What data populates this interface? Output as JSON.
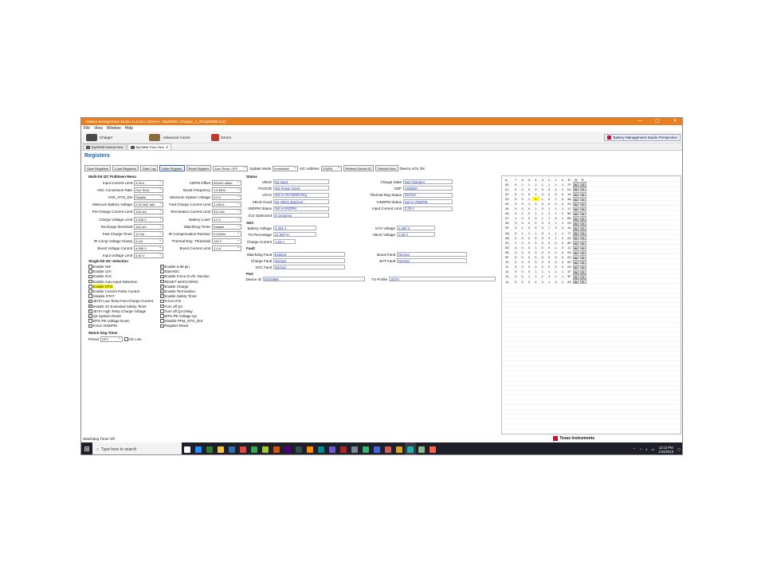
{
  "window": {
    "title": "Battery Management Studio v1.3.34.1 (Device - Bq25898 | Charger_1_00-bq25898.bqz)",
    "controls": [
      "—",
      "▢",
      "✕"
    ]
  },
  "menu": [
    "File",
    "View",
    "Window",
    "Help"
  ],
  "toolbar": {
    "items": [
      {
        "label": "Charger",
        "icon": "charger-icon",
        "color": "#4a4a4a"
      },
      {
        "label": "Advanced Comm",
        "icon": "advanced-comm-icon",
        "color": "#8a6d3b"
      },
      {
        "label": "Errors",
        "icon": "errors-icon",
        "color": "#c0392b"
      }
    ],
    "perspective": "Battery Management Studio Perspective"
  },
  "tabs": [
    {
      "label": "Bq25898 Default View",
      "active": false
    },
    {
      "label": "Bq25898 Field View",
      "active": true
    }
  ],
  "registers_title": "Registers",
  "buttons": {
    "save": "Save Registers",
    "load": "Load Registers",
    "start_log": "Start Log",
    "write": "Write Register",
    "read": "Read Register",
    "auto_read": "Auto Read: OFF",
    "update_mode_label": "Update Mode",
    "update_mode": "Immediate",
    "i2c_label": "I2C Address",
    "i2c": "D6(6B)",
    "refresh": "Refresh Device ID",
    "default_view": "Default View",
    "device_status": "Device ACK OK"
  },
  "multibit": {
    "title": "Multi-bit I2C Pulldown Menu",
    "left": [
      {
        "label": "Input Current Limit",
        "value": "3.25 A"
      },
      {
        "label": "ADC Conversion Rate",
        "value": "One Shot"
      },
      {
        "label": "VOK_OTG_EN",
        "value": "Disable"
      },
      {
        "label": "Minimum Battery Voltage",
        "value": "2.9V BAT falli"
      },
      {
        "label": "Pre-Charge Current Limit",
        "value": "128 mA"
      },
      {
        "label": "Charge Voltage Limit",
        "value": "4.208 V"
      },
      {
        "label": "Recharge threshold",
        "value": "100 mV"
      },
      {
        "label": "Fast Charge Timer",
        "value": "12 hrs"
      },
      {
        "label": "IR Comp Voltage Clamp",
        "value": "0 mV"
      },
      {
        "label": "Boost Voltage Control",
        "value": "4.998 V"
      },
      {
        "label": "Input Voltage Limit",
        "value": "4.40 V"
      }
    ],
    "right": [
      {
        "label": "VDPM Offset",
        "value": "600mV offset"
      },
      {
        "label": "Boost Frequency",
        "value": "1.5 MHz"
      },
      {
        "label": "Minimum System Voltage",
        "value": "3.5 V"
      },
      {
        "label": "Fast Charge Current Limit",
        "value": "2.048 A"
      },
      {
        "label": "Termination Current Limit",
        "value": "512 mA"
      },
      {
        "label": "Battery LowV",
        "value": "3.0 V"
      },
      {
        "label": "WatchDog Timer",
        "value": "Disable"
      },
      {
        "label": "IR Compensation Resistor",
        "value": "0 mOhm"
      },
      {
        "label": "Thermal Reg. Threshold",
        "value": "120 C"
      },
      {
        "label": "Boost Current Limit",
        "value": "2.4 A"
      }
    ]
  },
  "singlebit": {
    "title": "Single-bit I2C Selection",
    "left": [
      {
        "label": "Enable HIZ",
        "checked": false
      },
      {
        "label": "Enable 12V",
        "checked": false
      },
      {
        "label": "Enable ICO",
        "checked": false
      },
      {
        "label": "Enable Auto-Input Detection",
        "checked": false
      },
      {
        "label": "Enable OTG",
        "checked": false,
        "highlight": true
      },
      {
        "label": "Enable Current Pulse Control",
        "checked": false
      },
      {
        "label": "Disable STAT",
        "checked": false
      },
      {
        "label": "JEITA Low Temp Fast Charge Current",
        "checked": true
      },
      {
        "label": "Enable 2X Extended Safety Timer",
        "checked": true
      },
      {
        "label": "JEITA High Temp Charge Voltage",
        "checked": true
      },
      {
        "label": "Q4 System Reset",
        "checked": true
      },
      {
        "label": "MTK-PE Voltage Down",
        "checked": false
      },
      {
        "label": "Force VINDPM",
        "checked": false
      }
    ],
    "right": [
      {
        "label": "Enable ILIM pin",
        "checked": true
      },
      {
        "label": "StartADC",
        "checked": false
      },
      {
        "label": "Enable Force D+/D- Dection",
        "checked": false
      },
      {
        "label": "RESET WATCHDOG",
        "checked": false
      },
      {
        "label": "Enable Charge",
        "checked": true
      },
      {
        "label": "Enable Termination",
        "checked": true
      },
      {
        "label": "Enable Safety Timer",
        "checked": true
      },
      {
        "label": "Force ICO",
        "checked": false
      },
      {
        "label": "Turn off Q4",
        "checked": false
      },
      {
        "label": "Turn off Q4 Delay",
        "checked": false
      },
      {
        "label": "MTK-PE Voltage Up",
        "checked": false
      },
      {
        "label": "Disable PFM_OTG_DIS",
        "checked": false
      },
      {
        "label": "Register Reset",
        "checked": false
      }
    ]
  },
  "watchdog": {
    "title": "Watch Dog Timer",
    "period_label": "Period",
    "period": "OFF",
    "ce_low": "CE Low"
  },
  "status": {
    "title": "Status",
    "left": [
      {
        "label": "VBUS",
        "value": "No Input"
      },
      {
        "label": "PGOOD",
        "value": "Not Power Good"
      },
      {
        "label": "VSYS",
        "value": "Not in VSYSMIN Reg"
      },
      {
        "label": "VBUS Good",
        "value": "No VBUS attached"
      },
      {
        "label": "IINDPM Status",
        "value": "Not in IINDPM"
      },
      {
        "label": "ICO Optimized",
        "value": "In progress"
      }
    ],
    "right": [
      {
        "label": "Charge State",
        "value": "Not Charging"
      },
      {
        "label": "SDP",
        "value": "USB500"
      },
      {
        "label": "Thermal Reg Status",
        "value": "Normal"
      },
      {
        "label": "VINDPM Status",
        "value": "Not in VINDPM"
      },
      {
        "label": "Input Current Limit",
        "value": "3.25 A"
      }
    ]
  },
  "adc": {
    "title": "ADC",
    "battery_voltage": {
      "label": "Battery Voltage",
      "value": "2.304 V"
    },
    "ts_percentage": {
      "label": "TS Percentage",
      "value": "21.000 %"
    },
    "charge_current": {
      "label": "Charge Current",
      "value": "1.55 A"
    },
    "sys_voltage": {
      "label": "SYS Voltage",
      "value": "2.304 V"
    },
    "vbus_voltage": {
      "label": "VBUS Voltage",
      "value": "2.60 V"
    }
  },
  "fault": {
    "title": "Fault",
    "watchdog": {
      "label": "Watchdog Fault",
      "value": "Expired"
    },
    "charge": {
      "label": "Charge Fault",
      "value": "Normal"
    },
    "ntc": {
      "label": "NTC Fault",
      "value": "Normal"
    },
    "boost": {
      "label": "Boost Fault",
      "value": "Normal"
    },
    "bat": {
      "label": "BAT Fault",
      "value": "Normal"
    }
  },
  "part": {
    "title": "Part",
    "device_id": {
      "label": "Device ID",
      "value": "BQ25898"
    },
    "ts_profile": {
      "label": "TS Profile",
      "value": "JEITA"
    }
  },
  "register_table": {
    "headers": [
      "A",
      "7",
      "6",
      "5",
      "4",
      "3",
      "2",
      "1",
      "0",
      "D",
      "W",
      "R"
    ],
    "rows": [
      [
        "00",
        "0",
        "1",
        "1",
        "1",
        "1",
        "1",
        "1",
        "1",
        "7F"
      ],
      [
        "01",
        "0",
        "0",
        "0",
        "0",
        "0",
        "0",
        "0",
        "1",
        "01"
      ],
      [
        "02",
        "0",
        "0",
        "0",
        "1",
        "0",
        "0",
        "0",
        "0",
        "10"
      ],
      [
        "03",
        "0",
        "0",
        "1",
        "1",
        "1",
        "0",
        "1",
        "0",
        "3A"
      ],
      [
        "04",
        "0",
        "0",
        "1",
        "0",
        "0",
        "0",
        "0",
        "0",
        "20"
      ],
      [
        "05",
        "0",
        "0",
        "0",
        "1",
        "0",
        "1",
        "1",
        "1",
        "17"
      ],
      [
        "06",
        "0",
        "1",
        "0",
        "1",
        "1",
        "1",
        "1",
        "0",
        "5E"
      ],
      [
        "07",
        "1",
        "0",
        "0",
        "0",
        "1",
        "1",
        "0",
        "1",
        "8D"
      ],
      [
        "08",
        "0",
        "0",
        "0",
        "0",
        "0",
        "0",
        "1",
        "1",
        "03"
      ],
      [
        "09",
        "0",
        "1",
        "0",
        "0",
        "0",
        "1",
        "0",
        "0",
        "44"
      ],
      [
        "0A",
        "0",
        "1",
        "1",
        "1",
        "0",
        "1",
        "1",
        "1",
        "77"
      ],
      [
        "0B",
        "0",
        "0",
        "0",
        "0",
        "0",
        "0",
        "1",
        "0",
        "02"
      ],
      [
        "0C",
        "1",
        "0",
        "0",
        "0",
        "0",
        "0",
        "0",
        "0",
        "80"
      ],
      [
        "0D",
        "0",
        "0",
        "0",
        "1",
        "0",
        "0",
        "1",
        "0",
        "12"
      ],
      [
        "0E",
        "0",
        "0",
        "0",
        "0",
        "0",
        "0",
        "0",
        "0",
        "00"
      ],
      [
        "0F",
        "0",
        "0",
        "0",
        "0",
        "0",
        "0",
        "0",
        "0",
        "00"
      ],
      [
        "10",
        "0",
        "0",
        "0",
        "0",
        "0",
        "0",
        "0",
        "0",
        "00"
      ],
      [
        "11",
        "0",
        "0",
        "0",
        "0",
        "0",
        "0",
        "0",
        "0",
        "00"
      ],
      [
        "12",
        "0",
        "0",
        "0",
        "1",
        "1",
        "1",
        "1",
        "1",
        "1F"
      ],
      [
        "13",
        "0",
        "0",
        "1",
        "1",
        "1",
        "1",
        "1",
        "1",
        "3F"
      ],
      [
        "14",
        "0",
        "0",
        "0",
        "0",
        "0",
        "1",
        "0",
        "1",
        "05"
      ]
    ],
    "w_label": "W",
    "r_label": "R",
    "highlight_cell": {
      "row": 3,
      "col": 4
    }
  },
  "statusbar": "Watchdog Timer Off",
  "brand": "Texas Instruments",
  "taskbar": {
    "search_placeholder": "Type here to search",
    "time": "12:13 PM",
    "date": "1/16/2018",
    "apps": [
      {
        "icon": "task-view-icon",
        "color": "#ffffff"
      },
      {
        "icon": "edge-icon",
        "color": "#1e90ff"
      },
      {
        "icon": "store-icon",
        "color": "#2e7d32"
      },
      {
        "icon": "file-explorer-icon",
        "color": "#f4c542"
      },
      {
        "icon": "mail-icon",
        "color": "#2f6db5"
      },
      {
        "icon": "chrome-icon",
        "color": "#e8453c"
      },
      {
        "icon": "app-icon",
        "color": "#35a853"
      },
      {
        "icon": "app-icon-2",
        "color": "#9acd32"
      },
      {
        "icon": "app-icon-3",
        "color": "#d35400"
      },
      {
        "icon": "app-icon-4",
        "color": "#4b0082"
      },
      {
        "icon": "app-icon-5",
        "color": "#2f4f4f"
      },
      {
        "icon": "app-icon-6",
        "color": "#ff8c00"
      },
      {
        "icon": "app-icon-7",
        "color": "#008b8b"
      },
      {
        "icon": "app-icon-8",
        "color": "#6a5acd"
      },
      {
        "icon": "app-icon-9",
        "color": "#b22222"
      },
      {
        "icon": "app-icon-10",
        "color": "#778899"
      },
      {
        "icon": "app-icon-11",
        "color": "#3cb371"
      },
      {
        "icon": "app-icon-12",
        "color": "#4169e1"
      },
      {
        "icon": "app-icon-13",
        "color": "#cd5c5c"
      },
      {
        "icon": "app-icon-14",
        "color": "#daa520"
      },
      {
        "icon": "app-icon-15",
        "color": "#20b2aa"
      },
      {
        "icon": "app-icon-16",
        "color": "#8fbc8f"
      },
      {
        "icon": "app-icon-17",
        "color": "#ff6347"
      }
    ]
  }
}
